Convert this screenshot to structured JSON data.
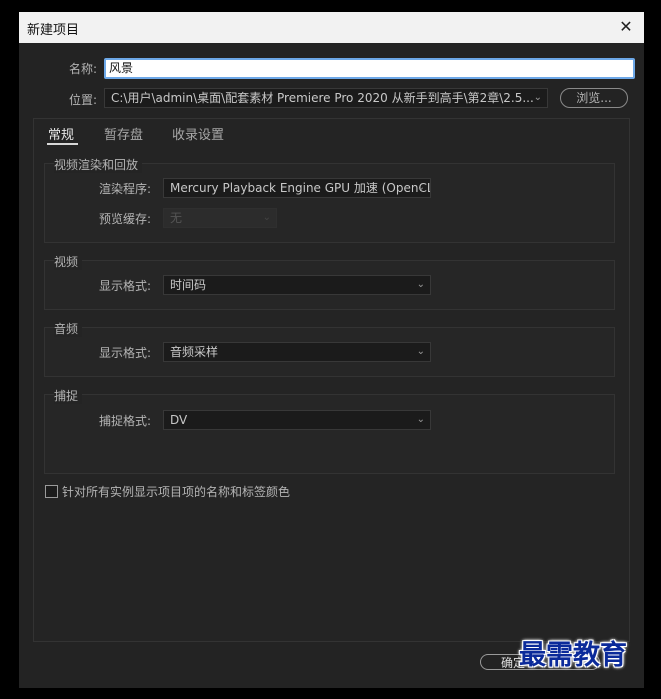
{
  "window": {
    "title": "新建项目",
    "close": "✕"
  },
  "form": {
    "name_label": "名称:",
    "name_value": "风景",
    "location_label": "位置:",
    "location_value": "C:\\用户\\admin\\桌面\\配套素材 Premiere Pro 2020 从新手到高手\\第2章\\2.5...",
    "browse_label": "浏览..."
  },
  "tabs": [
    {
      "label": "常规",
      "active": true
    },
    {
      "label": "暂存盘",
      "active": false
    },
    {
      "label": "收录设置",
      "active": false
    }
  ],
  "groups": {
    "render": {
      "title": "视频渲染和回放",
      "renderer_label": "渲染程序:",
      "renderer_value": "Mercury Playback Engine GPU 加速 (OpenCL)",
      "preview_cache_label": "预览缓存:",
      "preview_cache_value": "无"
    },
    "video": {
      "title": "视频",
      "format_label": "显示格式:",
      "format_value": "时间码"
    },
    "audio": {
      "title": "音频",
      "format_label": "显示格式:",
      "format_value": "音频采样"
    },
    "capture": {
      "title": "捕捉",
      "format_label": "捕捉格式:",
      "format_value": "DV"
    }
  },
  "checkbox": {
    "label": "针对所有实例显示项目项的名称和标签颜色",
    "checked": false
  },
  "buttons": {
    "ok_label": "确定"
  },
  "watermark": "最需教育",
  "colors": {
    "background": "#232323",
    "titlebar": "#f2f2f2",
    "input_focus": "#6da8e8",
    "watermark": "#0b2a9a"
  }
}
